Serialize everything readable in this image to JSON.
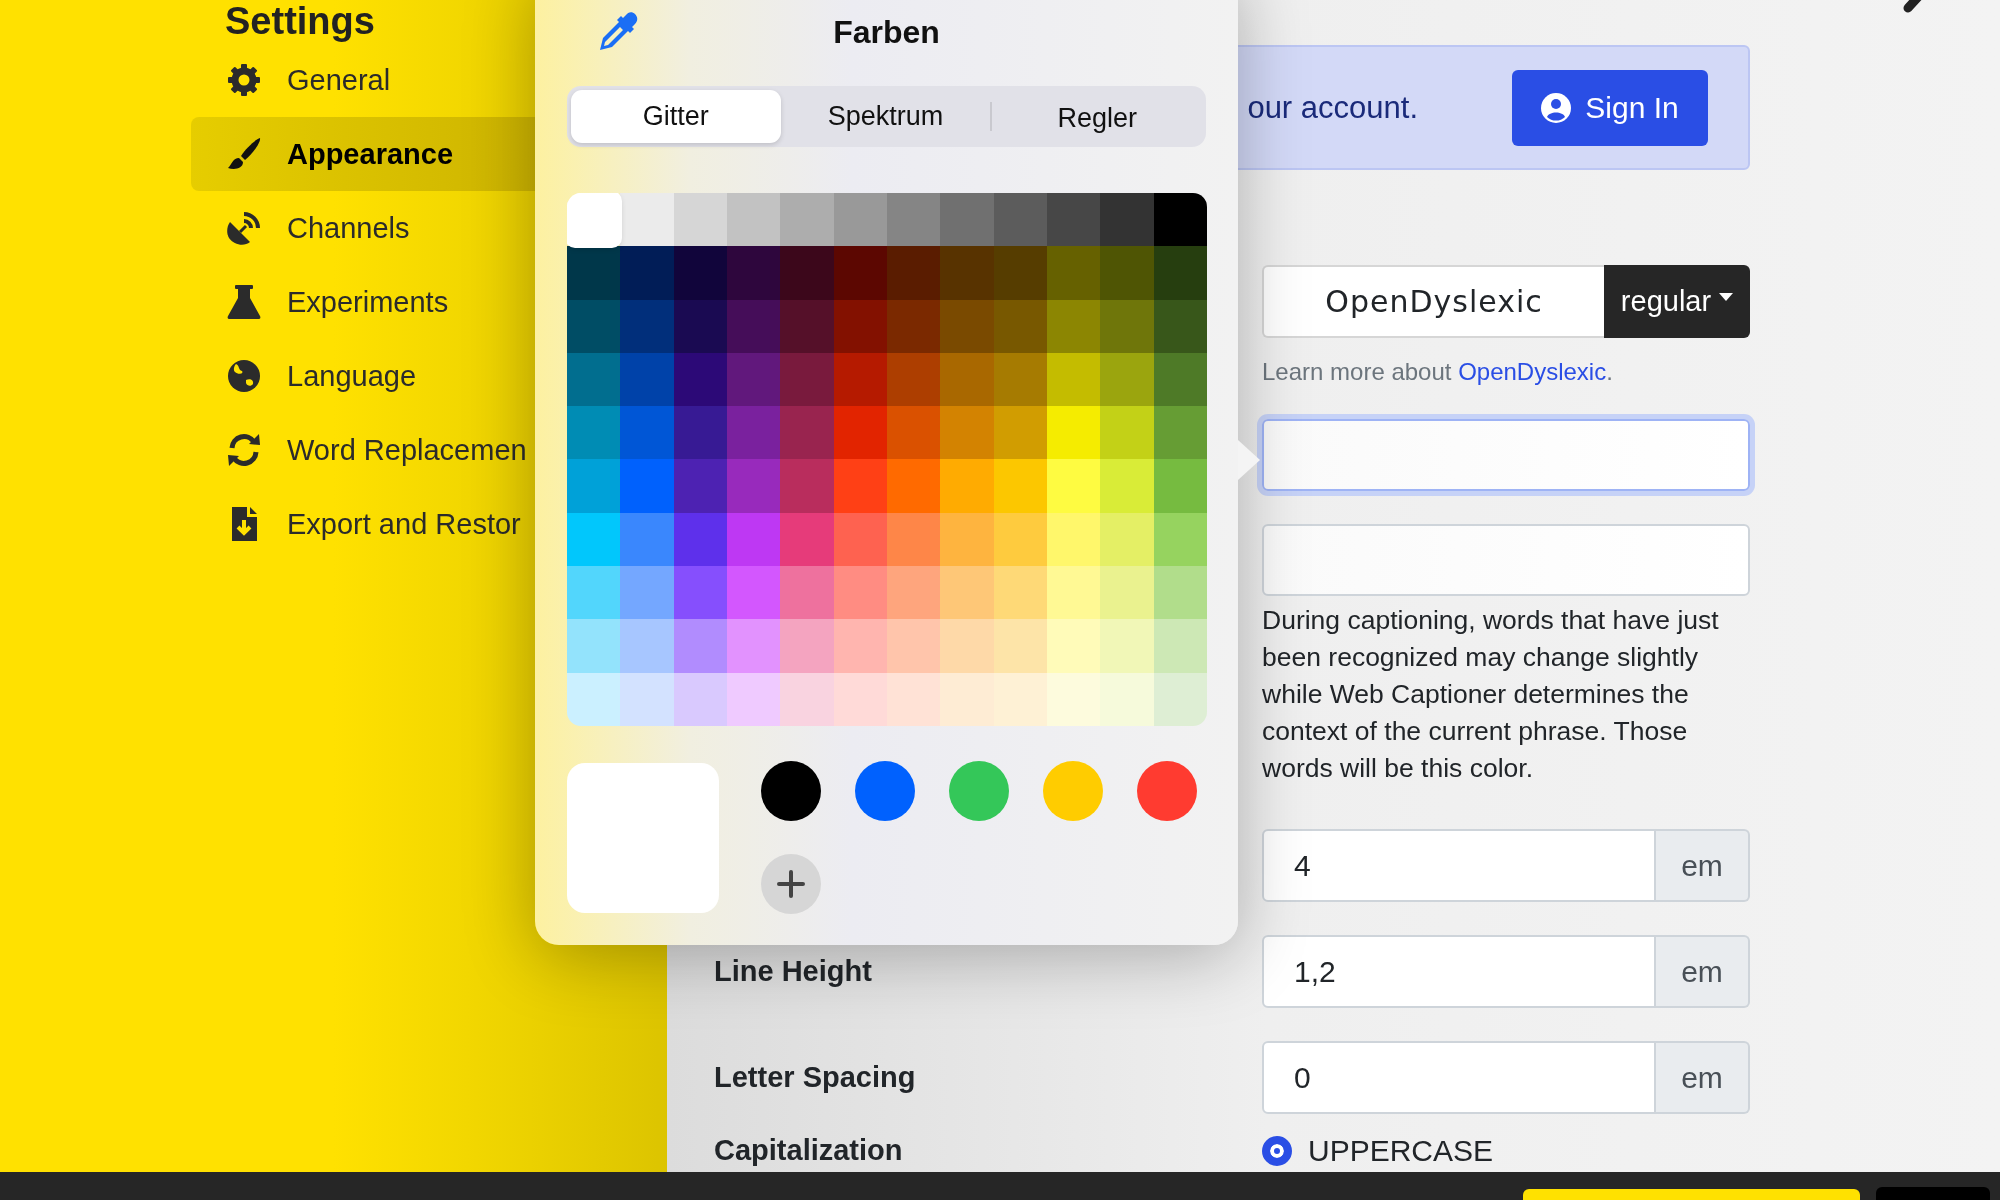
{
  "sidebar": {
    "title": "Settings",
    "items": [
      {
        "label": "General",
        "selected": false
      },
      {
        "label": "Appearance",
        "selected": true
      },
      {
        "label": "Channels",
        "selected": false
      },
      {
        "label": "Experiments",
        "selected": false
      },
      {
        "label": "Language",
        "selected": false
      },
      {
        "label": "Word Replacemen",
        "selected": false
      },
      {
        "label": "Export and Restor",
        "selected": false
      }
    ]
  },
  "picker": {
    "title": "Farben",
    "tabs": [
      {
        "label": "Gitter",
        "selected": true
      },
      {
        "label": "Spektrum",
        "selected": false
      },
      {
        "label": "Regler",
        "selected": false
      }
    ],
    "grid": [
      [
        {
          "color": "#ffffff",
          "selected": true
        },
        {
          "color": "#ebebeb",
          "selected": false
        },
        {
          "color": "#d6d6d6",
          "selected": false
        },
        {
          "color": "#c2c2c2",
          "selected": false
        },
        {
          "color": "#adadad",
          "selected": false
        },
        {
          "color": "#999999",
          "selected": false
        },
        {
          "color": "#858585",
          "selected": false
        },
        {
          "color": "#707070",
          "selected": false
        },
        {
          "color": "#5c5c5c",
          "selected": false
        },
        {
          "color": "#474747",
          "selected": false
        },
        {
          "color": "#333333",
          "selected": false
        },
        {
          "color": "#000000",
          "selected": false
        }
      ],
      [
        {
          "color": "#00374a",
          "selected": false
        },
        {
          "color": "#011d57",
          "selected": false
        },
        {
          "color": "#11053b",
          "selected": false
        },
        {
          "color": "#2e063d",
          "selected": false
        },
        {
          "color": "#3c071b",
          "selected": false
        },
        {
          "color": "#5c0701",
          "selected": false
        },
        {
          "color": "#5a1c00",
          "selected": false
        },
        {
          "color": "#583300",
          "selected": false
        },
        {
          "color": "#563d00",
          "selected": false
        },
        {
          "color": "#666100",
          "selected": false
        },
        {
          "color": "#4f5504",
          "selected": false
        },
        {
          "color": "#263e0f",
          "selected": false
        }
      ],
      [
        {
          "color": "#004d65",
          "selected": false
        },
        {
          "color": "#012f7b",
          "selected": false
        },
        {
          "color": "#1a0a52",
          "selected": false
        },
        {
          "color": "#450d59",
          "selected": false
        },
        {
          "color": "#551029",
          "selected": false
        },
        {
          "color": "#831100",
          "selected": false
        },
        {
          "color": "#7b2900",
          "selected": false
        },
        {
          "color": "#7a4a00",
          "selected": false
        },
        {
          "color": "#785800",
          "selected": false
        },
        {
          "color": "#8c8602",
          "selected": false
        },
        {
          "color": "#6f760a",
          "selected": false
        },
        {
          "color": "#38571a",
          "selected": false
        }
      ],
      [
        {
          "color": "#016e8f",
          "selected": false
        },
        {
          "color": "#0042a9",
          "selected": false
        },
        {
          "color": "#2c0977",
          "selected": false
        },
        {
          "color": "#61187c",
          "selected": false
        },
        {
          "color": "#791a3d",
          "selected": false
        },
        {
          "color": "#b51a00",
          "selected": false
        },
        {
          "color": "#ad3e00",
          "selected": false
        },
        {
          "color": "#a96800",
          "selected": false
        },
        {
          "color": "#a67b01",
          "selected": false
        },
        {
          "color": "#c4bc00",
          "selected": false
        },
        {
          "color": "#9ba50e",
          "selected": false
        },
        {
          "color": "#4e7a27",
          "selected": false
        }
      ],
      [
        {
          "color": "#008cb4",
          "selected": false
        },
        {
          "color": "#0056d6",
          "selected": false
        },
        {
          "color": "#371a94",
          "selected": false
        },
        {
          "color": "#7a219e",
          "selected": false
        },
        {
          "color": "#99244f",
          "selected": false
        },
        {
          "color": "#e22400",
          "selected": false
        },
        {
          "color": "#da5100",
          "selected": false
        },
        {
          "color": "#d38301",
          "selected": false
        },
        {
          "color": "#d19d01",
          "selected": false
        },
        {
          "color": "#f5ec00",
          "selected": false
        },
        {
          "color": "#c3d117",
          "selected": false
        },
        {
          "color": "#669d34",
          "selected": false
        }
      ],
      [
        {
          "color": "#00a1d8",
          "selected": false
        },
        {
          "color": "#0061fd",
          "selected": false
        },
        {
          "color": "#4d22b2",
          "selected": false
        },
        {
          "color": "#982abc",
          "selected": false
        },
        {
          "color": "#b92d5d",
          "selected": false
        },
        {
          "color": "#ff4015",
          "selected": false
        },
        {
          "color": "#ff6a00",
          "selected": false
        },
        {
          "color": "#ffab01",
          "selected": false
        },
        {
          "color": "#fcc700",
          "selected": false
        },
        {
          "color": "#fefb41",
          "selected": false
        },
        {
          "color": "#d9ec37",
          "selected": false
        },
        {
          "color": "#76bb40",
          "selected": false
        }
      ],
      [
        {
          "color": "#01c7fc",
          "selected": false
        },
        {
          "color": "#3a87fd",
          "selected": false
        },
        {
          "color": "#5e30eb",
          "selected": false
        },
        {
          "color": "#be38f3",
          "selected": false
        },
        {
          "color": "#e63b7a",
          "selected": false
        },
        {
          "color": "#fe6250",
          "selected": false
        },
        {
          "color": "#fe8648",
          "selected": false
        },
        {
          "color": "#feb43f",
          "selected": false
        },
        {
          "color": "#fecb3e",
          "selected": false
        },
        {
          "color": "#fff76b",
          "selected": false
        },
        {
          "color": "#e4ef65",
          "selected": false
        },
        {
          "color": "#96d35f",
          "selected": false
        }
      ],
      [
        {
          "color": "#52d6fc",
          "selected": false
        },
        {
          "color": "#74a7ff",
          "selected": false
        },
        {
          "color": "#864ffd",
          "selected": false
        },
        {
          "color": "#d357fe",
          "selected": false
        },
        {
          "color": "#ee719e",
          "selected": false
        },
        {
          "color": "#ff8c82",
          "selected": false
        },
        {
          "color": "#fea57d",
          "selected": false
        },
        {
          "color": "#fec777",
          "selected": false
        },
        {
          "color": "#fed977",
          "selected": false
        },
        {
          "color": "#fff994",
          "selected": false
        },
        {
          "color": "#eaf28f",
          "selected": false
        },
        {
          "color": "#b1dd8b",
          "selected": false
        }
      ],
      [
        {
          "color": "#93e3fc",
          "selected": false
        },
        {
          "color": "#a7c6ff",
          "selected": false
        },
        {
          "color": "#b18cfe",
          "selected": false
        },
        {
          "color": "#e292fe",
          "selected": false
        },
        {
          "color": "#f4a4c0",
          "selected": false
        },
        {
          "color": "#ffb5af",
          "selected": false
        },
        {
          "color": "#ffc5ab",
          "selected": false
        },
        {
          "color": "#fed9a8",
          "selected": false
        },
        {
          "color": "#fde4a8",
          "selected": false
        },
        {
          "color": "#fffbb9",
          "selected": false
        },
        {
          "color": "#f1f7b7",
          "selected": false
        },
        {
          "color": "#cde8b5",
          "selected": false
        }
      ],
      [
        {
          "color": "#cbf0ff",
          "selected": false
        },
        {
          "color": "#d3e2ff",
          "selected": false
        },
        {
          "color": "#d9c9fe",
          "selected": false
        },
        {
          "color": "#efcaff",
          "selected": false
        },
        {
          "color": "#f9d3e0",
          "selected": false
        },
        {
          "color": "#ffdad8",
          "selected": false
        },
        {
          "color": "#ffe2d6",
          "selected": false
        },
        {
          "color": "#feecd4",
          "selected": false
        },
        {
          "color": "#fef1d5",
          "selected": false
        },
        {
          "color": "#fdfbdd",
          "selected": false
        },
        {
          "color": "#f6fadb",
          "selected": false
        },
        {
          "color": "#deeed4",
          "selected": false
        }
      ]
    ],
    "swatches": [
      {
        "color": "#000000"
      },
      {
        "color": "#0061fe"
      },
      {
        "color": "#34c759"
      },
      {
        "color": "#ffcc00"
      },
      {
        "color": "#ff3b30"
      }
    ]
  },
  "banner": {
    "text": "our account.",
    "button": "Sign In"
  },
  "font": {
    "value": "OpenDyslexic",
    "variant": "regular"
  },
  "font_note": {
    "text": "Learn more about ",
    "link": "OpenDyslexic",
    "end": "."
  },
  "color_fields": [
    {
      "focused": true
    },
    {
      "focused": false
    }
  ],
  "color_help": "During captioning, words that have just been recognized may change slightly while Web Captioner determines the context of the current phrase. Those words will be this color.",
  "size_fields": [
    {
      "value": "4",
      "unit": "em"
    },
    {
      "label": "Line Height",
      "value": "1,2",
      "unit": "em"
    },
    {
      "label": "Letter Spacing",
      "value": "0",
      "unit": "em"
    }
  ],
  "capitalization": {
    "label": "Capitalization",
    "options": [
      {
        "label": "UPPERCASE",
        "selected": true
      }
    ]
  }
}
